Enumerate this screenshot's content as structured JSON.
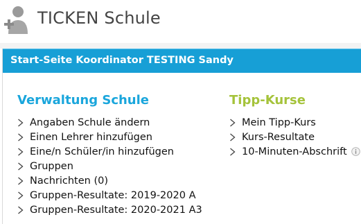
{
  "header": {
    "app_title": "TICKEN Schule",
    "logo_icon": "user-add-icon"
  },
  "panel": {
    "title": "Start-Seite Koordinator TESTING Sandy"
  },
  "left": {
    "title": "Verwaltung Schule",
    "items": [
      {
        "label": "Angaben Schule ändern"
      },
      {
        "label": "Einen Lehrer hinzufügen"
      },
      {
        "label": "Eine/n Schüler/in hinzufügen"
      },
      {
        "label": "Gruppen"
      },
      {
        "label": "Nachrichten (0)"
      },
      {
        "label": "Gruppen-Resultate: 2019-2020 A"
      },
      {
        "label": "Gruppen-Resultate: 2020-2021 A3"
      }
    ]
  },
  "right": {
    "title": "Tipp-Kurse",
    "items": [
      {
        "label": "Mein Tipp-Kurs"
      },
      {
        "label": "Kurs-Resultate"
      },
      {
        "label": "10-Minuten-Abschrift",
        "icon": "info-icon"
      }
    ]
  },
  "colors": {
    "panel_header": "#179fd6",
    "left_title": "#1aa6dc",
    "right_title": "#a5c33b"
  }
}
